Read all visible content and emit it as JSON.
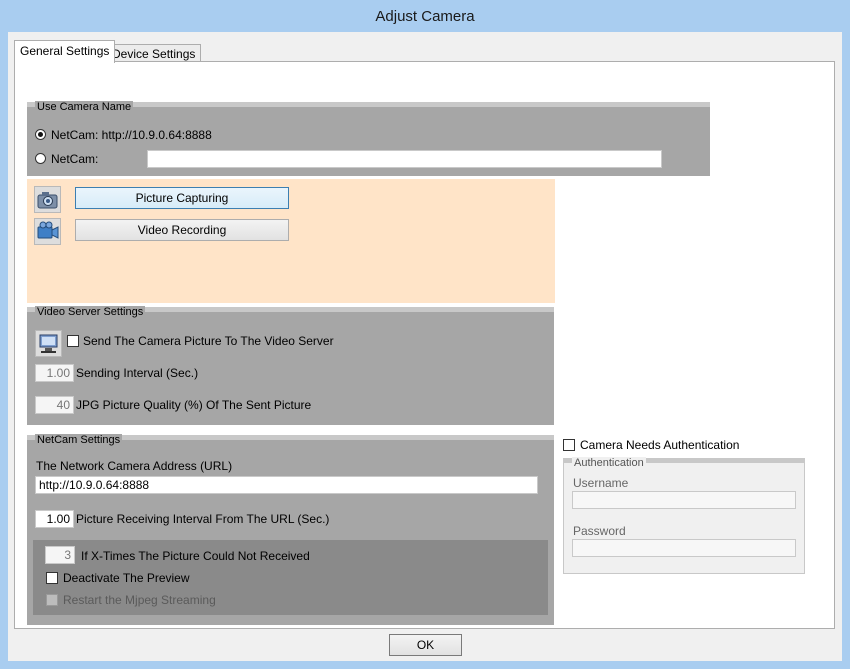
{
  "window": {
    "title": "Adjust Camera"
  },
  "tabs": [
    {
      "label": "General Settings"
    },
    {
      "label": "Device Settings"
    }
  ],
  "use_camera_name": {
    "title": "Use Camera Name",
    "option1_label": "NetCam: http://10.9.0.64:8888",
    "option2_label": "NetCam:",
    "option2_value": ""
  },
  "capture": {
    "picture_label": "Picture Capturing",
    "video_label": "Video Recording"
  },
  "video_server": {
    "title": "Video Server Settings",
    "send_label": "Send The Camera Picture To The Video Server",
    "interval_value": "1.00",
    "interval_label": "Sending Interval (Sec.)",
    "quality_value": "40",
    "quality_label": "JPG Picture Quality (%) Of The Sent Picture"
  },
  "netcam": {
    "title": "NetCam Settings",
    "address_label": "The Network Camera Address (URL)",
    "address_value": "http://10.9.0.64:8888",
    "receive_value": "1.00",
    "receive_label": "Picture Receiving Interval From The URL (Sec.)",
    "times_value": "3",
    "times_label": "If X-Times The Picture Could Not Received",
    "deactivate_label": "Deactivate The Preview",
    "restart_label": "Restart the Mjpeg Streaming"
  },
  "auth": {
    "needs_label": "Camera Needs Authentication",
    "title": "Authentication",
    "username_label": "Username",
    "username_value": "",
    "password_label": "Password",
    "password_value": ""
  },
  "footer": {
    "ok_label": "OK"
  },
  "colors": {
    "peach_panel": "#ffe4c8",
    "group_gray": "#a6a6a6",
    "titlebar": "#a9cdf0"
  },
  "icons": [
    "camera-icon",
    "video-camera-icon",
    "video-server-icon"
  ]
}
